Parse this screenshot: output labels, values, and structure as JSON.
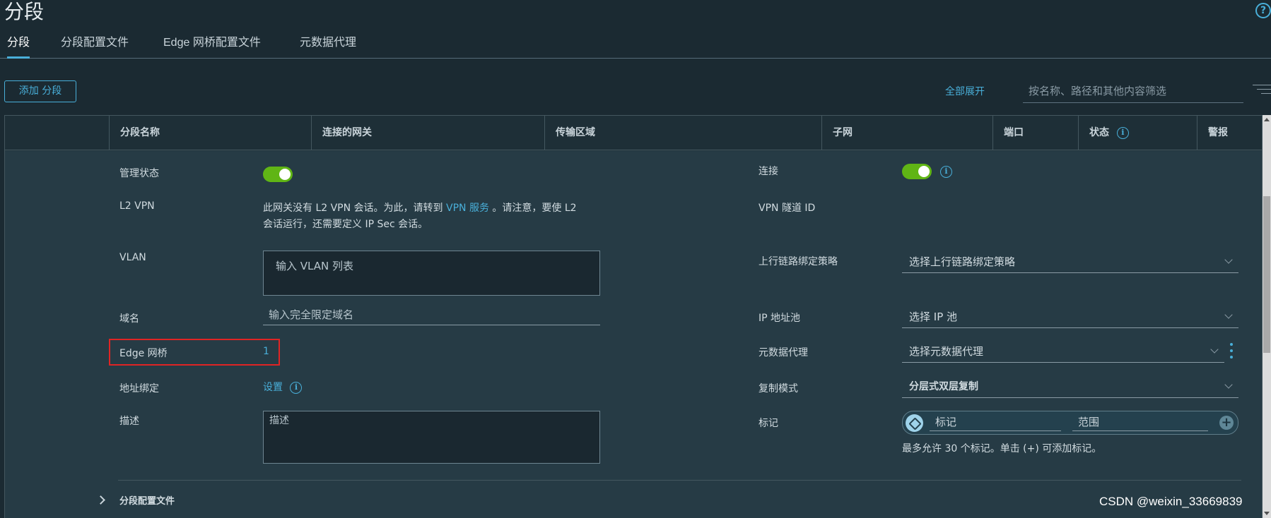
{
  "page": {
    "title": "分段",
    "help_icon": "?"
  },
  "tabs": [
    {
      "label": "分段",
      "active": true
    },
    {
      "label": "分段配置文件",
      "active": false
    },
    {
      "label": "Edge 网桥配置文件",
      "active": false
    },
    {
      "label": "元数据代理",
      "active": false
    }
  ],
  "toolbar": {
    "add_label": "添加 分段",
    "expand_all_label": "全部展开",
    "filter_placeholder": "按名称、路径和其他内容筛选"
  },
  "grid": {
    "columns": [
      "分段名称",
      "连接的网关",
      "传输区域",
      "子网",
      "端口",
      "状态",
      "警报"
    ]
  },
  "detail": {
    "admin_state": {
      "label": "管理状态",
      "enabled": true
    },
    "connection": {
      "label": "连接",
      "enabled": true
    },
    "l2vpn": {
      "label": "L2 VPN",
      "text_line1_before": "此网关没有 L2 VPN 会话。为此，请转到",
      "link": "VPN 服务",
      "text_line1_after": "。请注意，要使 L2",
      "text_line2": "会话运行，还需要定义 IP Sec 会话。"
    },
    "vpn_tunnel": {
      "label": "VPN 隧道 ID"
    },
    "vlan": {
      "label": "VLAN",
      "placeholder": "输入 VLAN 列表"
    },
    "uplink_teaming": {
      "label": "上行链路绑定策略",
      "placeholder": "选择上行链路绑定策略"
    },
    "domain": {
      "label": "域名",
      "placeholder": "输入完全限定域名"
    },
    "ip_pool": {
      "label": "IP 地址池",
      "placeholder": "选择 IP 池"
    },
    "edge_bridge": {
      "label": "Edge 网桥",
      "value": "1"
    },
    "metadata_proxy": {
      "label": "元数据代理",
      "placeholder": "选择元数据代理"
    },
    "address_binding": {
      "label": "地址绑定",
      "link": "设置"
    },
    "replication_mode": {
      "label": "复制模式",
      "value": "分层式双层复制"
    },
    "description": {
      "label": "描述",
      "placeholder": "描述"
    },
    "tags": {
      "label": "标记",
      "tag_placeholder": "标记",
      "scope_placeholder": "范围",
      "hint": "最多允许 30 个标记。单击 (+) 可添加标记。"
    },
    "segment_profiles": {
      "label": "分段配置文件"
    }
  },
  "watermark": "CSDN @weixin_33669839",
  "colors": {
    "accent": "#49afd9",
    "toggle_on": "#60b515",
    "highlight": "#e02424"
  }
}
